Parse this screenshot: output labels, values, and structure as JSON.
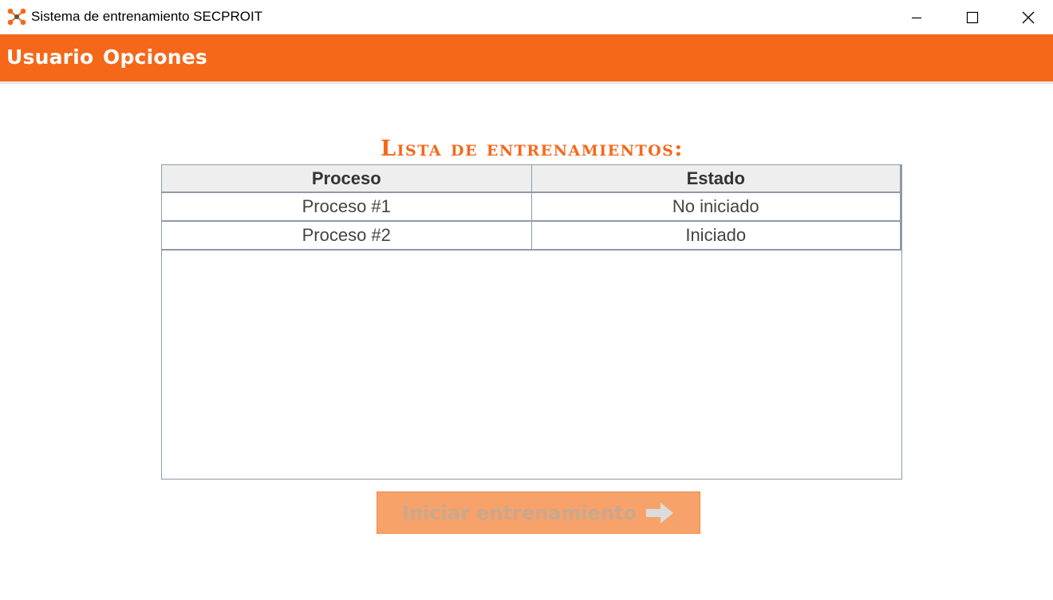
{
  "window": {
    "title": "Sistema de entrenamiento SECPROIT",
    "controls": [
      "minimize",
      "maximize",
      "close"
    ]
  },
  "menu": {
    "items": [
      {
        "label": "Usuario"
      },
      {
        "label": "Opciones"
      }
    ]
  },
  "main": {
    "heading": "Lista de entrenamientos:",
    "table": {
      "columns": [
        "Proceso",
        "Estado"
      ],
      "rows": [
        {
          "proceso": "Proceso #1",
          "estado": "No iniciado"
        },
        {
          "proceso": "Proceso #2",
          "estado": "Iniciado"
        }
      ]
    },
    "start_button": {
      "label": "Iniciar entrenamiento",
      "icon": "arrow-right-icon",
      "enabled": false
    }
  },
  "colors": {
    "accent": "#f5681a",
    "button_disabled_bg": "#f7a26a",
    "table_border": "#8f9aa8",
    "header_bg": "#eeeeee"
  }
}
